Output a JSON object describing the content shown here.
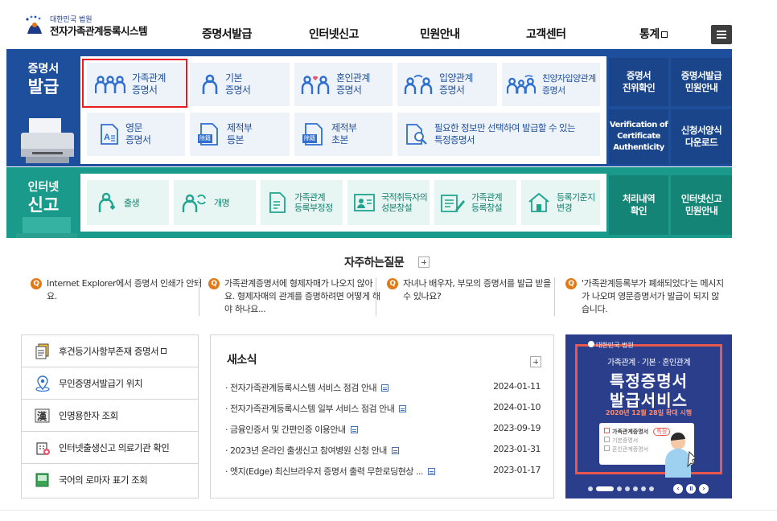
{
  "header": {
    "logo_small": "대한민국 법원",
    "logo_big": "전자가족관계등록시스템",
    "nav": [
      {
        "label": "증명서발급"
      },
      {
        "label": "인터넷신고"
      },
      {
        "label": "민원안내"
      },
      {
        "label": "고객센터"
      },
      {
        "label": "통계"
      }
    ]
  },
  "issue": {
    "title_top": "증명서",
    "title_bottom": "발급",
    "tiles_row1": [
      {
        "l1": "가족관계",
        "l2": "증명서"
      },
      {
        "l1": "기본",
        "l2": "증명서"
      },
      {
        "l1": "혼인관계",
        "l2": "증명서"
      },
      {
        "l1": "입양관계",
        "l2": "증명서"
      },
      {
        "l1": "친양자입양관계",
        "l2": "증명서"
      }
    ],
    "tiles_row2": [
      {
        "l1": "영문",
        "l2": "증명서"
      },
      {
        "l1": "제적부",
        "l2": "등본",
        "tag": "除籍"
      },
      {
        "l1": "제적부",
        "l2": "초본",
        "tag": "除籍"
      },
      {
        "l1": "필요한 정보만 선택하여 발급할 수 있는",
        "l2": "특정증명서"
      }
    ],
    "side": [
      {
        "l1": "증명서",
        "l2": "진위확인"
      },
      {
        "l1": "증명서발급",
        "l2": "민원안내"
      },
      {
        "l1": "Verification of",
        "l2": "Certificate",
        "l3": "Authenticity"
      },
      {
        "l1": "신청서양식",
        "l2": "다운로드"
      }
    ]
  },
  "report": {
    "title_top": "인터넷",
    "title_bottom": "신고",
    "tiles": [
      {
        "l1": "출생",
        "l2": ""
      },
      {
        "l1": "개명",
        "l2": ""
      },
      {
        "l1": "가족관계",
        "l2": "등록부정정"
      },
      {
        "l1": "국적취득자의",
        "l2": "성본창설"
      },
      {
        "l1": "가족관계",
        "l2": "등록창설"
      },
      {
        "l1": "등록기준지",
        "l2": "변경"
      }
    ],
    "side": [
      {
        "l1": "처리내역",
        "l2": "확인"
      },
      {
        "l1": "인터넷신고",
        "l2": "민원안내"
      }
    ]
  },
  "faq": {
    "title": "자주하는질문",
    "q_mark": "Q",
    "items": [
      {
        "text": "Internet Explorer에서 증명서 인쇄가 안돼요."
      },
      {
        "text": "가족관계증명서에 형제자매가 나오지 않아요. 형제자매의 관계를 증명하려면 어떻게 해야 하나요..."
      },
      {
        "text": "자녀나 배우자, 부모의 증명서를 발급 받을 수 있나요?"
      },
      {
        "text": "'가족관계등록부가 폐쇄되었다'는 메시지가 나오며 영문증명서가 발급이 되지 않습니다."
      }
    ]
  },
  "quick": [
    {
      "label": "후견등기사항부존재 증명서"
    },
    {
      "label": "무인증명서발급기 위치"
    },
    {
      "label": "인명용한자 조회"
    },
    {
      "label": "인터넷출생신고 의료기관 확인"
    },
    {
      "label": "국어의 로마자 표기 조회"
    }
  ],
  "news": {
    "title": "새소식",
    "items": [
      {
        "title": "전자가족관계등록시스템 서비스 점검 안내",
        "date": "2024-01-11"
      },
      {
        "title": "전자가족관계등록시스템 일부 서비스 점검 안내",
        "date": "2024-01-10"
      },
      {
        "title": "금융인증서 및 간편인증 이용안내",
        "date": "2023-09-19"
      },
      {
        "title": "2023년 온라인 출생신고 참여병원 신청 안내",
        "date": "2023-01-31"
      },
      {
        "title": "엣지(Edge) 최신브라우저 증명서 출력 무한로딩현상 ...",
        "date": "2023-01-17"
      }
    ]
  },
  "banner": {
    "small": "대한민국 법원",
    "sub": "가족관계 · 기본 · 혼인관계",
    "big1": "특정증명서",
    "big2": "발급서비스",
    "date": "2020년 12월 28일 확대 시행",
    "card1": "가족관계증명서",
    "card2": "기본증명서",
    "card3": "혼인관계증명서",
    "card_tag": "특정"
  },
  "colors": {
    "issue": "#1e4f9c",
    "report": "#199a8a",
    "accent": "#e51c23",
    "faq": "#e07a18"
  }
}
